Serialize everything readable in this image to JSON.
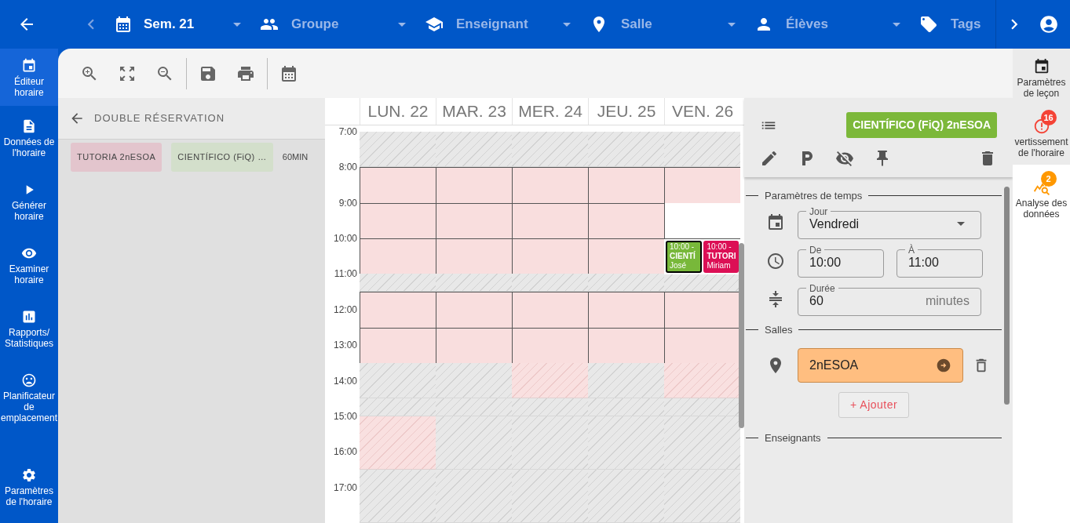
{
  "topbar": {
    "week": "Sem. 21",
    "filters": [
      {
        "kind": "group",
        "label": "Groupe"
      },
      {
        "kind": "teacher",
        "label": "Enseignant"
      },
      {
        "kind": "room",
        "label": "Salle"
      },
      {
        "kind": "students",
        "label": "Élèves"
      },
      {
        "kind": "tags",
        "label": "Tags"
      }
    ]
  },
  "nav": [
    {
      "kind": "editor",
      "label": "Éditeur horaire",
      "selected": true
    },
    {
      "kind": "data",
      "label": "Données de l'horaire",
      "selected": false
    },
    {
      "kind": "generate",
      "label": "Générer horaire",
      "selected": false
    },
    {
      "kind": "review",
      "label": "Examiner horaire",
      "selected": false
    },
    {
      "kind": "reports",
      "label": "Rapports/ Statistiques",
      "selected": false
    },
    {
      "kind": "planner",
      "label": "Planificateur de emplacement",
      "selected": false
    },
    {
      "kind": "settings",
      "label": "Paramètres de l'horaire",
      "selected": false
    }
  ],
  "conflicts": {
    "title": "DOUBLE RÉSERVATION",
    "chips": [
      {
        "label": "TUTORIA 2nESOA",
        "color": "#e3c5cd"
      },
      {
        "label": "CIENTÍFICO (FiQ) …",
        "color": "#d3dfcb"
      }
    ],
    "duration": "60MIN"
  },
  "calendar": {
    "hours": [
      "7:00",
      "8:00",
      "9:00",
      "10:00",
      "11:00",
      "12:00",
      "13:00",
      "14:00",
      "15:00",
      "16:00",
      "17:00"
    ],
    "days": [
      {
        "label": "LUN. 22",
        "periods": [
          {
            "kind": "unavailable"
          },
          {
            "kind": "blocked"
          },
          {
            "kind": "blocked"
          },
          {
            "kind": "blocked"
          },
          {
            "kind": "unavailable"
          },
          {
            "kind": "blocked"
          },
          {
            "kind": "blocked"
          },
          {
            "kind": "unavailable"
          },
          {
            "kind": "unavailable"
          },
          {
            "kind": "partial"
          },
          {
            "kind": "unavailable"
          }
        ]
      },
      {
        "label": "MAR. 23",
        "periods": [
          {
            "kind": "unavailable"
          },
          {
            "kind": "blocked"
          },
          {
            "kind": "blocked"
          },
          {
            "kind": "blocked"
          },
          {
            "kind": "unavailable"
          },
          {
            "kind": "blocked"
          },
          {
            "kind": "blocked"
          },
          {
            "kind": "unavailable"
          },
          {
            "kind": "unavailable"
          },
          {
            "kind": "unavailable"
          },
          {
            "kind": "unavailable"
          }
        ]
      },
      {
        "label": "MER. 24",
        "periods": [
          {
            "kind": "unavailable"
          },
          {
            "kind": "blocked"
          },
          {
            "kind": "blocked"
          },
          {
            "kind": "blocked"
          },
          {
            "kind": "unavailable"
          },
          {
            "kind": "blocked"
          },
          {
            "kind": "blocked"
          },
          {
            "kind": "partial"
          },
          {
            "kind": "unavailable"
          },
          {
            "kind": "unavailable"
          },
          {
            "kind": "unavailable"
          }
        ]
      },
      {
        "label": "JEU. 25",
        "periods": [
          {
            "kind": "unavailable"
          },
          {
            "kind": "blocked"
          },
          {
            "kind": "blocked"
          },
          {
            "kind": "blocked"
          },
          {
            "kind": "unavailable"
          },
          {
            "kind": "blocked"
          },
          {
            "kind": "blocked"
          },
          {
            "kind": "unavailable"
          },
          {
            "kind": "unavailable"
          },
          {
            "kind": "unavailable"
          },
          {
            "kind": "unavailable"
          }
        ]
      },
      {
        "label": "VEN. 26",
        "periods": [
          {
            "kind": "unavailable"
          },
          {
            "kind": "blocked"
          },
          {
            "kind": "free"
          },
          {
            "kind": "lessons",
            "events": [
              {
                "time": "10:00 -",
                "title": "CIENTÍ",
                "person": "José",
                "color": "#78b83a",
                "selected": true
              },
              {
                "time": "10:00 -",
                "title": "TUTORI",
                "person": "Miriam",
                "color": "#dc0f55",
                "selected": false
              }
            ]
          },
          {
            "kind": "unavailable"
          },
          {
            "kind": "blocked"
          },
          {
            "kind": "blocked"
          },
          {
            "kind": "partial"
          },
          {
            "kind": "unavailable"
          },
          {
            "kind": "unavailable"
          },
          {
            "kind": "unavailable"
          }
        ]
      }
    ]
  },
  "lesson": {
    "title": "CIENTÍFICO (FiQ) 2nESOA",
    "color": "#7cb83a",
    "time": {
      "heading": "Paramètres de temps",
      "day": {
        "label": "Jour",
        "value": "Vendredi"
      },
      "from": {
        "label": "De",
        "value": "10:00"
      },
      "to": {
        "label": "À",
        "value": "11:00"
      },
      "duration": {
        "label": "Durée",
        "value": "60",
        "unit": "minutes"
      }
    },
    "rooms": {
      "heading": "Salles",
      "items": [
        {
          "name": "2nESOA"
        }
      ],
      "add_button": "+ Ajouter"
    },
    "teachers": {
      "heading": "Enseignants"
    }
  },
  "rail": [
    {
      "kind": "lesson",
      "label": "Paramètres de leçon",
      "selected": true
    },
    {
      "kind": "warnings",
      "label": "vertissement de l'horaire",
      "badge": "16",
      "color": "#f44336",
      "selected": true
    },
    {
      "kind": "analysis",
      "label": "Analyse des données",
      "badge": "2",
      "color": "#ff9800",
      "selected": false
    }
  ]
}
